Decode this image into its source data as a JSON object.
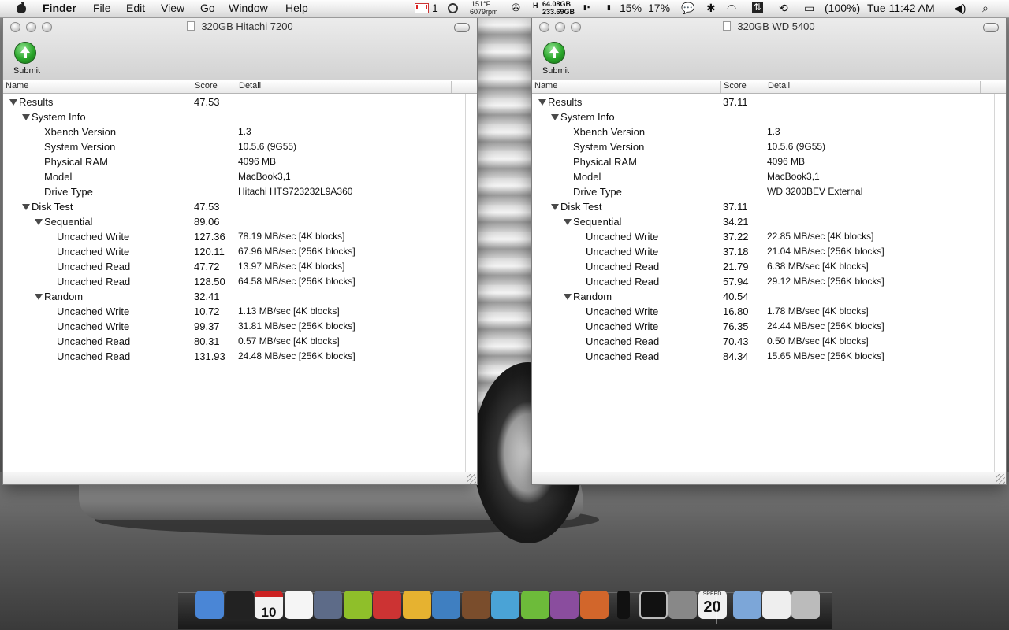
{
  "menubar": {
    "app": "Finder",
    "menus": [
      "File",
      "Edit",
      "View",
      "Go",
      "Window",
      "Help"
    ],
    "mail_count": "1",
    "temp": "151°F",
    "rpm": "6079rpm",
    "disk_free_1": "64.08GB",
    "disk_free_2": "233.69GB",
    "cpu_1": "15%",
    "cpu_2": "17%",
    "battery": "(100%)",
    "clock": "Tue 11:42 AM"
  },
  "columns": {
    "name": "Name",
    "score": "Score",
    "detail": "Detail"
  },
  "submit_label": "Submit",
  "windows": [
    {
      "title": "320GB Hitachi 7200",
      "rows": [
        {
          "name": "Results",
          "score": "47.53",
          "detail": ""
        },
        {
          "name": "System Info",
          "score": "",
          "detail": ""
        },
        {
          "name": "Xbench Version",
          "score": "",
          "detail": "1.3"
        },
        {
          "name": "System Version",
          "score": "",
          "detail": "10.5.6 (9G55)"
        },
        {
          "name": "Physical RAM",
          "score": "",
          "detail": "4096 MB"
        },
        {
          "name": "Model",
          "score": "",
          "detail": "MacBook3,1"
        },
        {
          "name": "Drive Type",
          "score": "",
          "detail": "Hitachi HTS723232L9A360"
        },
        {
          "name": "Disk Test",
          "score": "47.53",
          "detail": ""
        },
        {
          "name": "Sequential",
          "score": "89.06",
          "detail": ""
        },
        {
          "name": "Uncached Write",
          "score": "127.36",
          "detail": "78.19 MB/sec [4K blocks]"
        },
        {
          "name": "Uncached Write",
          "score": "120.11",
          "detail": "67.96 MB/sec [256K blocks]"
        },
        {
          "name": "Uncached Read",
          "score": "47.72",
          "detail": "13.97 MB/sec [4K blocks]"
        },
        {
          "name": "Uncached Read",
          "score": "128.50",
          "detail": "64.58 MB/sec [256K blocks]"
        },
        {
          "name": "Random",
          "score": "32.41",
          "detail": ""
        },
        {
          "name": "Uncached Write",
          "score": "10.72",
          "detail": "1.13 MB/sec [4K blocks]"
        },
        {
          "name": "Uncached Write",
          "score": "99.37",
          "detail": "31.81 MB/sec [256K blocks]"
        },
        {
          "name": "Uncached Read",
          "score": "80.31",
          "detail": "0.57 MB/sec [4K blocks]"
        },
        {
          "name": "Uncached Read",
          "score": "131.93",
          "detail": "24.48 MB/sec [256K blocks]"
        }
      ]
    },
    {
      "title": "320GB WD 5400",
      "rows": [
        {
          "name": "Results",
          "score": "37.11",
          "detail": ""
        },
        {
          "name": "System Info",
          "score": "",
          "detail": ""
        },
        {
          "name": "Xbench Version",
          "score": "",
          "detail": "1.3"
        },
        {
          "name": "System Version",
          "score": "",
          "detail": "10.5.6 (9G55)"
        },
        {
          "name": "Physical RAM",
          "score": "",
          "detail": "4096 MB"
        },
        {
          "name": "Model",
          "score": "",
          "detail": "MacBook3,1"
        },
        {
          "name": "Drive Type",
          "score": "",
          "detail": "WD 3200BEV External"
        },
        {
          "name": "Disk Test",
          "score": "37.11",
          "detail": ""
        },
        {
          "name": "Sequential",
          "score": "34.21",
          "detail": ""
        },
        {
          "name": "Uncached Write",
          "score": "37.22",
          "detail": "22.85 MB/sec [4K blocks]"
        },
        {
          "name": "Uncached Write",
          "score": "37.18",
          "detail": "21.04 MB/sec [256K blocks]"
        },
        {
          "name": "Uncached Read",
          "score": "21.79",
          "detail": "6.38 MB/sec [4K blocks]"
        },
        {
          "name": "Uncached Read",
          "score": "57.94",
          "detail": "29.12 MB/sec [256K blocks]"
        },
        {
          "name": "Random",
          "score": "40.54",
          "detail": ""
        },
        {
          "name": "Uncached Write",
          "score": "16.80",
          "detail": "1.78 MB/sec [4K blocks]"
        },
        {
          "name": "Uncached Write",
          "score": "76.35",
          "detail": "24.44 MB/sec [256K blocks]"
        },
        {
          "name": "Uncached Read",
          "score": "70.43",
          "detail": "0.50 MB/sec [4K blocks]"
        },
        {
          "name": "Uncached Read",
          "score": "84.34",
          "detail": "15.65 MB/sec [256K blocks]"
        }
      ]
    }
  ],
  "dock": {
    "calendar_day": "10",
    "speed_label": "SPEED",
    "speed_value": "20",
    "icons": [
      "finder-icon",
      "camera-icon",
      "calendar-icon",
      "gmail-icon",
      "itunes-icon",
      "dashboard-icon",
      "system-utility-icon",
      "cocktail-icon",
      "iphoto-icon",
      "garageband-icon",
      "wordpress-icon",
      "twitter-icon",
      "parallels-icon",
      "photo-editor-icon",
      "iphone-icon",
      "terminal-icon",
      "system-preferences-icon",
      "speed-icon",
      "folder-icon",
      "documents-icon",
      "trash-icon"
    ]
  }
}
